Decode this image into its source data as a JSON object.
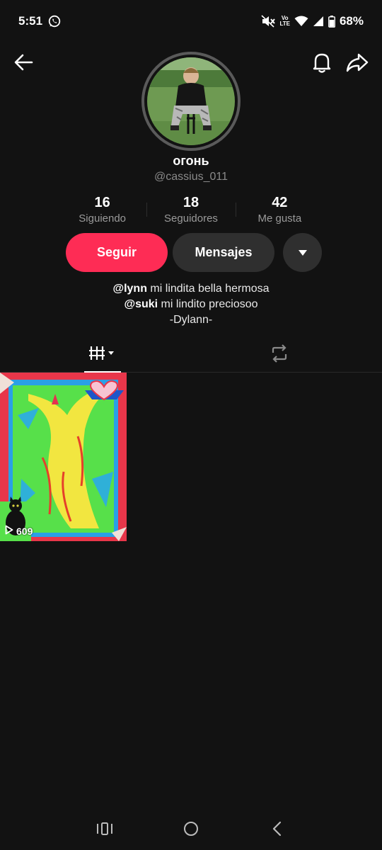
{
  "status_bar": {
    "time": "5:51",
    "battery": "68%",
    "volte_top": "Vo",
    "volte_bottom": "LTE",
    "icons": [
      "whatsapp-icon",
      "mute-icon",
      "volte-icon",
      "wifi-icon",
      "signal-icon",
      "battery-icon"
    ]
  },
  "top_nav": {
    "icons": [
      "back-arrow-icon",
      "bell-icon",
      "share-icon"
    ]
  },
  "profile": {
    "display_name": "огонь",
    "username": "@cassius_011"
  },
  "stats": [
    {
      "value": "16",
      "label": "Siguiendo"
    },
    {
      "value": "18",
      "label": "Seguidores"
    },
    {
      "value": "42",
      "label": "Me gusta"
    }
  ],
  "actions": {
    "follow_label": "Seguir",
    "message_label": "Mensajes",
    "accent_color": "#fe2c55"
  },
  "bio": {
    "line1_mention": "@lynn",
    "line1_text": " mi lindita bella hermosa",
    "line2_mention": "@suki",
    "line2_text": " mi lindito preciosoo",
    "line3": "-Dylann-"
  },
  "tabs": {
    "icons": [
      "videos-grid-icon",
      "repost-icon"
    ]
  },
  "videos": [
    {
      "views": "609"
    }
  ],
  "android_nav": {
    "icons": [
      "recents-icon",
      "home-icon",
      "back-icon"
    ]
  }
}
